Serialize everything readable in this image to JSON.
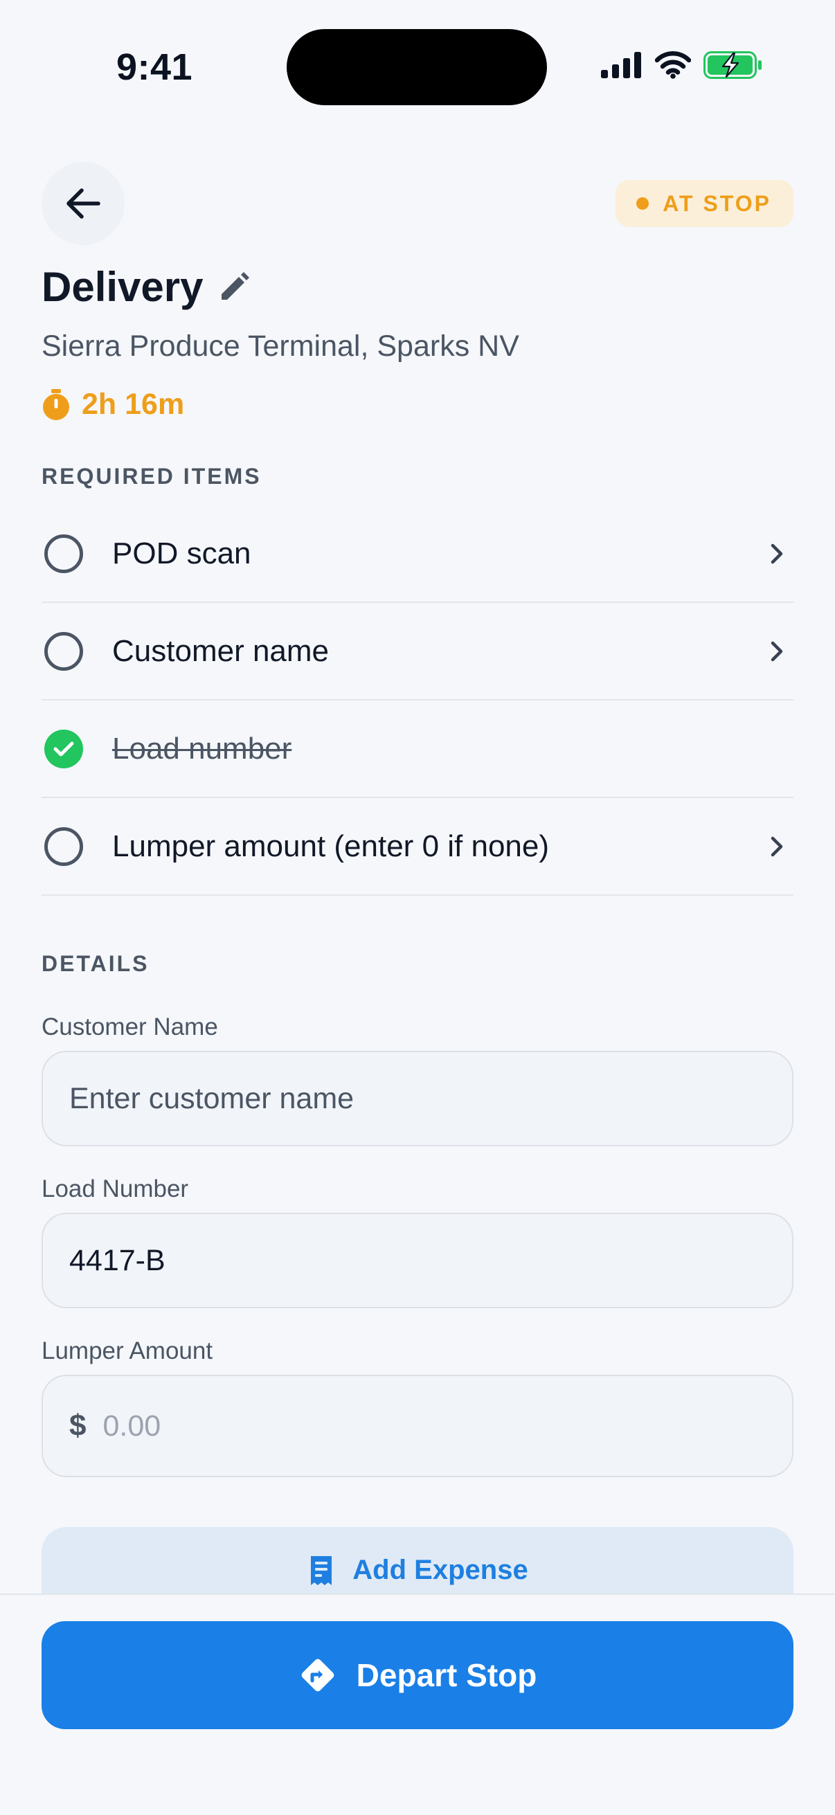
{
  "status_bar": {
    "time": "9:41"
  },
  "header": {
    "status_badge": "AT STOP",
    "title": "Delivery",
    "location": "Sierra Produce Terminal, Sparks NV",
    "dwell_time": "2h 16m"
  },
  "required": {
    "section_label": "REQUIRED ITEMS",
    "items": [
      {
        "label": "POD scan",
        "done": false
      },
      {
        "label": "Customer name",
        "done": false
      },
      {
        "label": "Load number",
        "done": true
      },
      {
        "label": "Lumper amount (enter 0 if none)",
        "done": false
      }
    ]
  },
  "details": {
    "section_label": "DETAILS",
    "customer_name": {
      "label": "Customer Name",
      "value": "",
      "placeholder": "Enter customer name"
    },
    "load_number": {
      "label": "Load Number",
      "value": "4417-B",
      "placeholder": ""
    },
    "lumper_amount": {
      "label": "Lumper Amount",
      "currency": "$",
      "value": "",
      "placeholder": "0.00"
    }
  },
  "actions": {
    "add_expense": "Add Expense",
    "depart_stop": "Depart Stop"
  },
  "colors": {
    "accent": "#1A7FE6",
    "warning": "#EE9E1B",
    "success": "#22C55E"
  }
}
